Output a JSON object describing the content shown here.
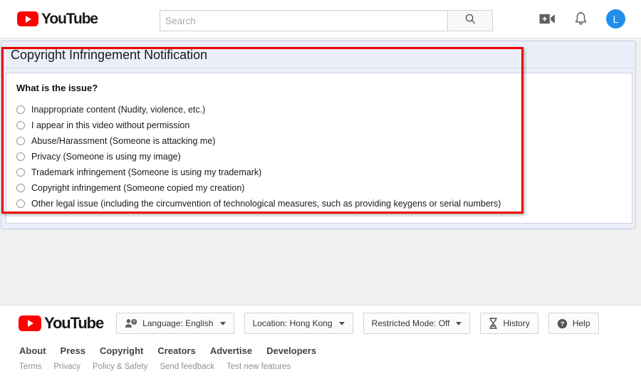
{
  "header": {
    "logo_text": "YouTube",
    "logo_color": "#ff0000",
    "search": {
      "placeholder": "Search",
      "value": ""
    },
    "icons": [
      {
        "name": "create-video-icon",
        "label": "Create"
      },
      {
        "name": "notifications-bell-icon",
        "label": "Notifications"
      }
    ],
    "avatar": {
      "initial": "L",
      "color": "#1f8eea"
    }
  },
  "form": {
    "title": "Copyright Infringement Notification",
    "question": "What is the issue?",
    "highlight_color": "#ee0000",
    "options": [
      {
        "id": "inappropriate-content",
        "label": "Inappropriate content (Nudity, violence, etc.)",
        "selected": false
      },
      {
        "id": "appear-without-permission",
        "label": "I appear in this video without permission",
        "selected": false
      },
      {
        "id": "abuse-harassment",
        "label": "Abuse/Harassment (Someone is attacking me)",
        "selected": false
      },
      {
        "id": "privacy",
        "label": "Privacy (Someone is using my image)",
        "selected": false
      },
      {
        "id": "trademark-infringement",
        "label": "Trademark infringement (Someone is using my trademark)",
        "selected": false
      },
      {
        "id": "copyright-infringement",
        "label": "Copyright infringement (Someone copied my creation)",
        "selected": false
      },
      {
        "id": "other-legal-issue",
        "label": "Other legal issue (including the circumvention of technological measures, such as providing keygens or serial numbers)",
        "selected": false
      }
    ]
  },
  "footer": {
    "logo_text": "YouTube",
    "buttons": [
      {
        "id": "language",
        "icon": "person-question-icon",
        "label": "Language: English",
        "caret": true
      },
      {
        "id": "location",
        "icon": null,
        "label": "Location: Hong Kong",
        "caret": true
      },
      {
        "id": "restricted-mode",
        "icon": null,
        "label": "Restricted Mode: Off",
        "caret": true
      },
      {
        "id": "history",
        "icon": "hourglass-icon",
        "label": "History",
        "caret": false
      },
      {
        "id": "help",
        "icon": "help-circle-icon",
        "label": "Help",
        "caret": false
      }
    ],
    "links_primary": [
      "About",
      "Press",
      "Copyright",
      "Creators",
      "Advertise",
      "Developers"
    ],
    "links_secondary": [
      "Terms",
      "Privacy",
      "Policy & Safety",
      "Send feedback",
      "Test new features"
    ]
  }
}
